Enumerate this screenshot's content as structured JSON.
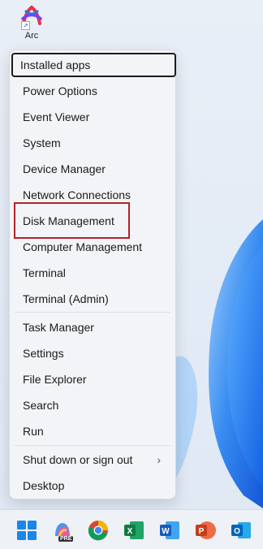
{
  "desktop": {
    "shortcut_label": "Arc"
  },
  "menu": {
    "items": [
      {
        "label": "Installed apps"
      },
      {
        "label": "Power Options"
      },
      {
        "label": "Event Viewer"
      },
      {
        "label": "System"
      },
      {
        "label": "Device Manager"
      },
      {
        "label": "Network Connections"
      },
      {
        "label": "Disk Management"
      },
      {
        "label": "Computer Management"
      },
      {
        "label": "Terminal"
      },
      {
        "label": "Terminal (Admin)"
      },
      {
        "label": "Task Manager"
      },
      {
        "label": "Settings"
      },
      {
        "label": "File Explorer"
      },
      {
        "label": "Search"
      },
      {
        "label": "Run"
      },
      {
        "label": "Shut down or sign out"
      },
      {
        "label": "Desktop"
      }
    ]
  },
  "taskbar": {
    "icons": [
      "windows-start-icon",
      "copilot-pre-icon",
      "chrome-icon",
      "excel-icon",
      "word-icon",
      "powerpoint-icon",
      "outlook-icon"
    ],
    "copilot_badge": "PRE"
  },
  "colors": {
    "highlight": "#b6202a",
    "accent_blue": "#1a73e8"
  }
}
